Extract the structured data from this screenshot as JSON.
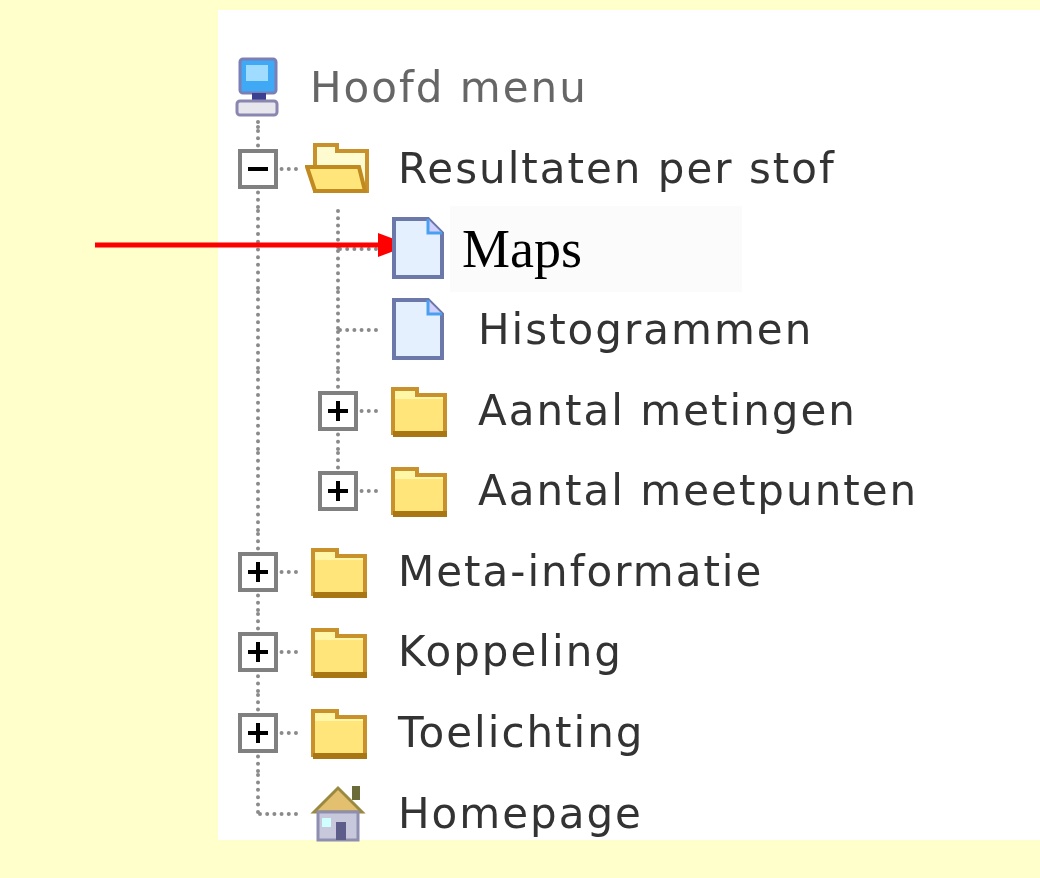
{
  "tree": {
    "root": {
      "label": "Hoofd menu",
      "kind": "computer"
    },
    "items": [
      {
        "label": "Resultaten per stof",
        "kind": "folder",
        "expanded": true,
        "selected": false,
        "children": [
          {
            "label": "Maps",
            "kind": "page",
            "selected": true
          },
          {
            "label": "Histogrammen",
            "kind": "page",
            "selected": false
          },
          {
            "label": "Aantal metingen",
            "kind": "folder",
            "expanded": false,
            "selected": false
          },
          {
            "label": "Aantal meetpunten",
            "kind": "folder",
            "expanded": false,
            "selected": false
          }
        ]
      },
      {
        "label": "Meta-informatie",
        "kind": "folder",
        "expanded": false,
        "selected": false
      },
      {
        "label": "Koppeling",
        "kind": "folder",
        "expanded": false,
        "selected": false
      },
      {
        "label": "Toelichting",
        "kind": "folder",
        "expanded": false,
        "selected": false
      },
      {
        "label": "Homepage",
        "kind": "home",
        "selected": false
      }
    ]
  }
}
